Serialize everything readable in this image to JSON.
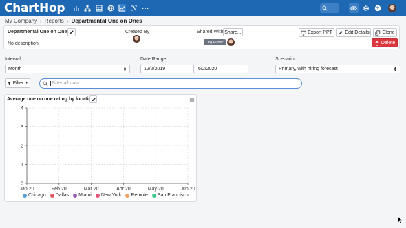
{
  "app": {
    "logo_text": "ChartHop"
  },
  "nav": {
    "icons": [
      "org-chart-icon",
      "data-chart-icon",
      "hierarchy-icon",
      "table-icon",
      "globe-icon",
      "reports-icon",
      "merge-icon",
      "more-icon"
    ],
    "right_icons": [
      "view-icon",
      "settings-icon",
      "help-icon",
      "user-avatar"
    ]
  },
  "breadcrumb": [
    "My Company",
    "Reports",
    "Departmental One on Ones"
  ],
  "report": {
    "name": "Departmental One on Ones",
    "description": "No description.",
    "created_by_label": "Created By",
    "shared_with_label": "Shared With",
    "share_button": "Share...",
    "share_badge": "Org Public",
    "export_button": "Export PPT",
    "edit_button": "Edit Details",
    "clone_button": "Clone",
    "delete_button": "Delete"
  },
  "controls": {
    "interval_label": "Interval",
    "interval_value": "Month",
    "date_range_label": "Date Range",
    "date_start": "12/2/2019",
    "date_end": "6/2/2020",
    "scenario_label": "Scenario",
    "scenario_value": "Primary, with hiring forecast",
    "filter_button": "Filter",
    "filter_placeholder": "Filter all data"
  },
  "chart_data": {
    "type": "line",
    "title": "Average one on one rating by location",
    "x_ticks": [
      "Jan 20",
      "Feb 20",
      "Mar 20",
      "Apr 20",
      "May 20",
      "Jun 20"
    ],
    "y_ticks": [
      "0",
      "1",
      "2",
      "3",
      "4"
    ],
    "ylim": [
      0,
      4
    ],
    "grid": true,
    "legend_placement": "bottom",
    "series": [
      {
        "name": "Chicago",
        "color": "#5b9bd5",
        "values": []
      },
      {
        "name": "Dallas",
        "color": "#e05a5a",
        "values": []
      },
      {
        "name": "Miami",
        "color": "#9b59b6",
        "values": []
      },
      {
        "name": "New York",
        "color": "#e0557a",
        "values": []
      },
      {
        "name": "Remote",
        "color": "#f0a35e",
        "values": []
      },
      {
        "name": "San Francisco",
        "color": "#3ecf8e",
        "values": []
      }
    ]
  }
}
